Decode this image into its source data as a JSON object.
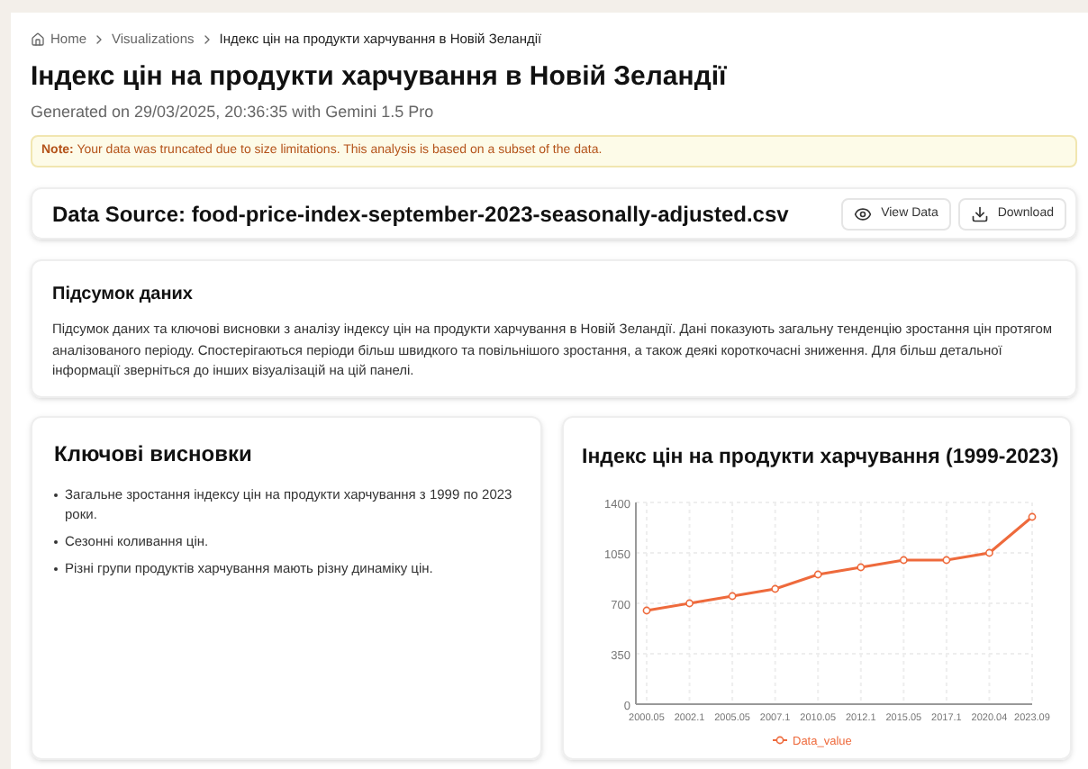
{
  "breadcrumb": [
    {
      "label": "Home",
      "kind": "home"
    },
    {
      "label": "Visualizations",
      "kind": "link"
    },
    {
      "label": "Індекс цін на продукти харчування в Новій Зеландії",
      "kind": "current"
    }
  ],
  "title": "Індекс цін на продукти харчування в Новій Зеландії",
  "subtitle": "Generated on 29/03/2025, 20:36:35 with Gemini 1.5 Pro",
  "note": {
    "label": "Note:",
    "text": "Your data was truncated due to size limitations. This analysis is based on a subset of the data."
  },
  "data_source": {
    "title": "Data Source: food-price-index-september-2023-seasonally-adjusted.csv",
    "buttons": [
      {
        "label": "View Data",
        "kind": "view"
      },
      {
        "label": "Download",
        "kind": "download"
      }
    ]
  },
  "summary": {
    "title": "Підсумок даних",
    "text": "Підсумок даних та ключові висновки з аналізу індексу цін на продукти харчування в Новій Зеландії. Дані показують загальну тенденцію зростання цін протягом аналізованого періоду. Спостерігаються періоди більш швидкого та повільнішого зростання, а також деякі короткочасні зниження. Для більш детальної інформації зверніться до інших візуалізацій на цій панелі."
  },
  "key_findings": {
    "title": "Ключові висновки",
    "items": [
      "Загальне зростання індексу цін на продукти харчування з 1999 по 2023 роки.",
      "Сезонні коливання цін.",
      "Різні групи продуктів харчування мають різну динаміку цін."
    ]
  },
  "chart": {
    "title": "Індекс цін на продукти харчування (1999-2023)",
    "chart_data": {
      "type": "line",
      "categories": [
        "2000.05",
        "2002.1",
        "2005.05",
        "2007.1",
        "2010.05",
        "2012.1",
        "2015.05",
        "2017.1",
        "2020.04",
        "2023.09"
      ],
      "series": [
        {
          "name": "Data_value",
          "color": "#ee6a3c",
          "marker": true,
          "values": [
            650,
            700,
            750,
            800,
            900,
            950,
            1000,
            1000,
            1050,
            1300
          ]
        }
      ],
      "grid": true,
      "ylim": [
        0,
        1400
      ],
      "yticks": [
        0,
        350,
        700,
        1050,
        1400
      ]
    }
  }
}
